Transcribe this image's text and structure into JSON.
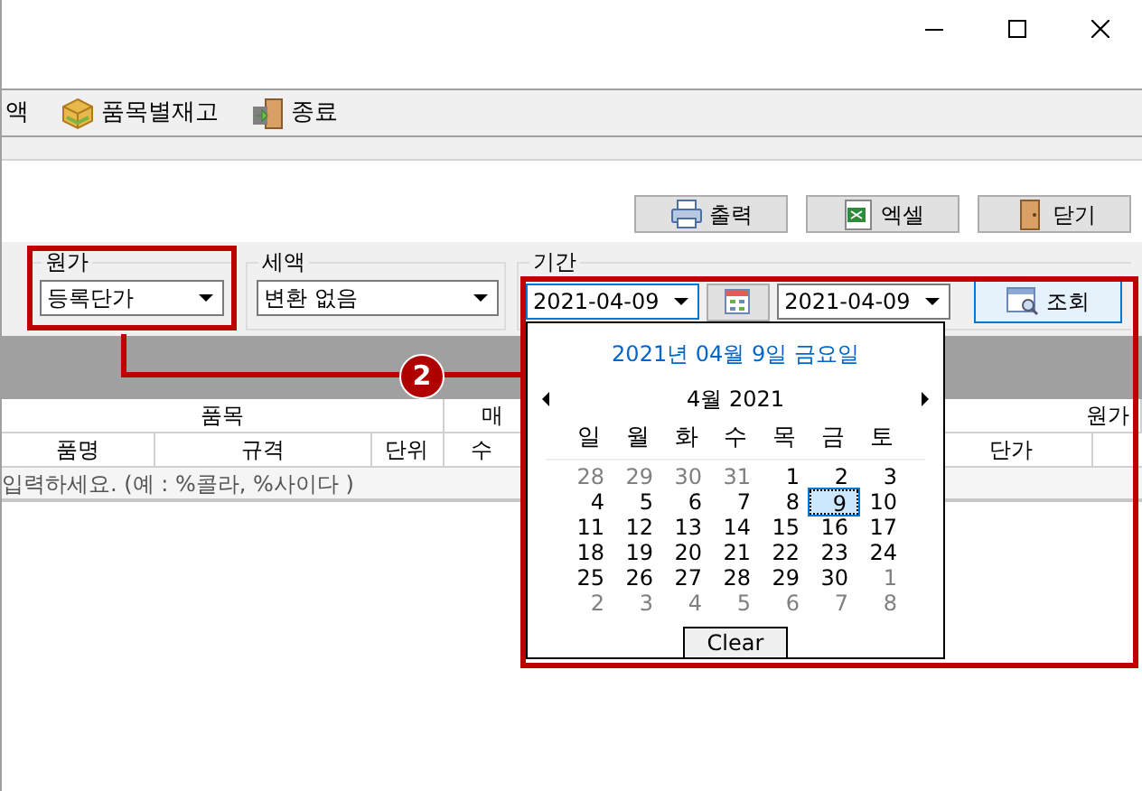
{
  "toolbar": [
    {
      "label": "액",
      "kind": "none"
    },
    {
      "label": "품목별재고",
      "kind": "box"
    },
    {
      "label": "종료",
      "kind": "exit"
    }
  ],
  "buttons": [
    {
      "label": "출력",
      "kind": "print"
    },
    {
      "label": "엑셀",
      "kind": "excel"
    },
    {
      "label": "닫기",
      "kind": "door"
    }
  ],
  "filters": {
    "cost": {
      "legend": "원가",
      "value": "등록단가",
      "highlighted": true
    },
    "tax": {
      "legend": "세액",
      "value": "변환 없음"
    },
    "period": {
      "legend": "기간",
      "from": "2021-04-09",
      "to": "2021-04-09",
      "highlighted": true
    },
    "search_button": {
      "label": "조회"
    }
  },
  "callout": {
    "number": "2"
  },
  "grid": {
    "groups": [
      {
        "label": "품목"
      },
      {
        "label": "매"
      },
      {
        "label": "원가"
      }
    ],
    "columns": [
      {
        "label": "품명"
      },
      {
        "label": "규격"
      },
      {
        "label": "단위"
      },
      {
        "label": "수"
      },
      {
        "label": "단가"
      }
    ],
    "filter_hint": "입력하세요. (예 : %콜라, %사이다 )"
  },
  "calendar": {
    "title": "2021년 04월 9일 금요일",
    "month_label": "4월 2021",
    "weekdays": [
      "일",
      "월",
      "화",
      "수",
      "목",
      "금",
      "토"
    ],
    "weeks": [
      [
        {
          "day": "28",
          "other_month": true,
          "selected": false
        },
        {
          "day": "29",
          "other_month": true,
          "selected": false
        },
        {
          "day": "30",
          "other_month": true,
          "selected": false
        },
        {
          "day": "31",
          "other_month": true,
          "selected": false
        },
        {
          "day": "1",
          "other_month": false,
          "selected": false
        },
        {
          "day": "2",
          "other_month": false,
          "selected": false
        },
        {
          "day": "3",
          "other_month": false,
          "selected": false
        }
      ],
      [
        {
          "day": "4",
          "other_month": false,
          "selected": false
        },
        {
          "day": "5",
          "other_month": false,
          "selected": false
        },
        {
          "day": "6",
          "other_month": false,
          "selected": false
        },
        {
          "day": "7",
          "other_month": false,
          "selected": false
        },
        {
          "day": "8",
          "other_month": false,
          "selected": false
        },
        {
          "day": "9",
          "other_month": false,
          "selected": true
        },
        {
          "day": "10",
          "other_month": false,
          "selected": false
        }
      ],
      [
        {
          "day": "11",
          "other_month": false,
          "selected": false
        },
        {
          "day": "12",
          "other_month": false,
          "selected": false
        },
        {
          "day": "13",
          "other_month": false,
          "selected": false
        },
        {
          "day": "14",
          "other_month": false,
          "selected": false
        },
        {
          "day": "15",
          "other_month": false,
          "selected": false
        },
        {
          "day": "16",
          "other_month": false,
          "selected": false
        },
        {
          "day": "17",
          "other_month": false,
          "selected": false
        }
      ],
      [
        {
          "day": "18",
          "other_month": false,
          "selected": false
        },
        {
          "day": "19",
          "other_month": false,
          "selected": false
        },
        {
          "day": "20",
          "other_month": false,
          "selected": false
        },
        {
          "day": "21",
          "other_month": false,
          "selected": false
        },
        {
          "day": "22",
          "other_month": false,
          "selected": false
        },
        {
          "day": "23",
          "other_month": false,
          "selected": false
        },
        {
          "day": "24",
          "other_month": false,
          "selected": false
        }
      ],
      [
        {
          "day": "25",
          "other_month": false,
          "selected": false
        },
        {
          "day": "26",
          "other_month": false,
          "selected": false
        },
        {
          "day": "27",
          "other_month": false,
          "selected": false
        },
        {
          "day": "28",
          "other_month": false,
          "selected": false
        },
        {
          "day": "29",
          "other_month": false,
          "selected": false
        },
        {
          "day": "30",
          "other_month": false,
          "selected": false
        },
        {
          "day": "1",
          "other_month": true,
          "selected": false
        }
      ],
      [
        {
          "day": "2",
          "other_month": true,
          "selected": false
        },
        {
          "day": "3",
          "other_month": true,
          "selected": false
        },
        {
          "day": "4",
          "other_month": true,
          "selected": false
        },
        {
          "day": "5",
          "other_month": true,
          "selected": false
        },
        {
          "day": "6",
          "other_month": true,
          "selected": false
        },
        {
          "day": "7",
          "other_month": true,
          "selected": false
        },
        {
          "day": "8",
          "other_month": true,
          "selected": false
        }
      ]
    ],
    "clear_button": "Clear"
  }
}
